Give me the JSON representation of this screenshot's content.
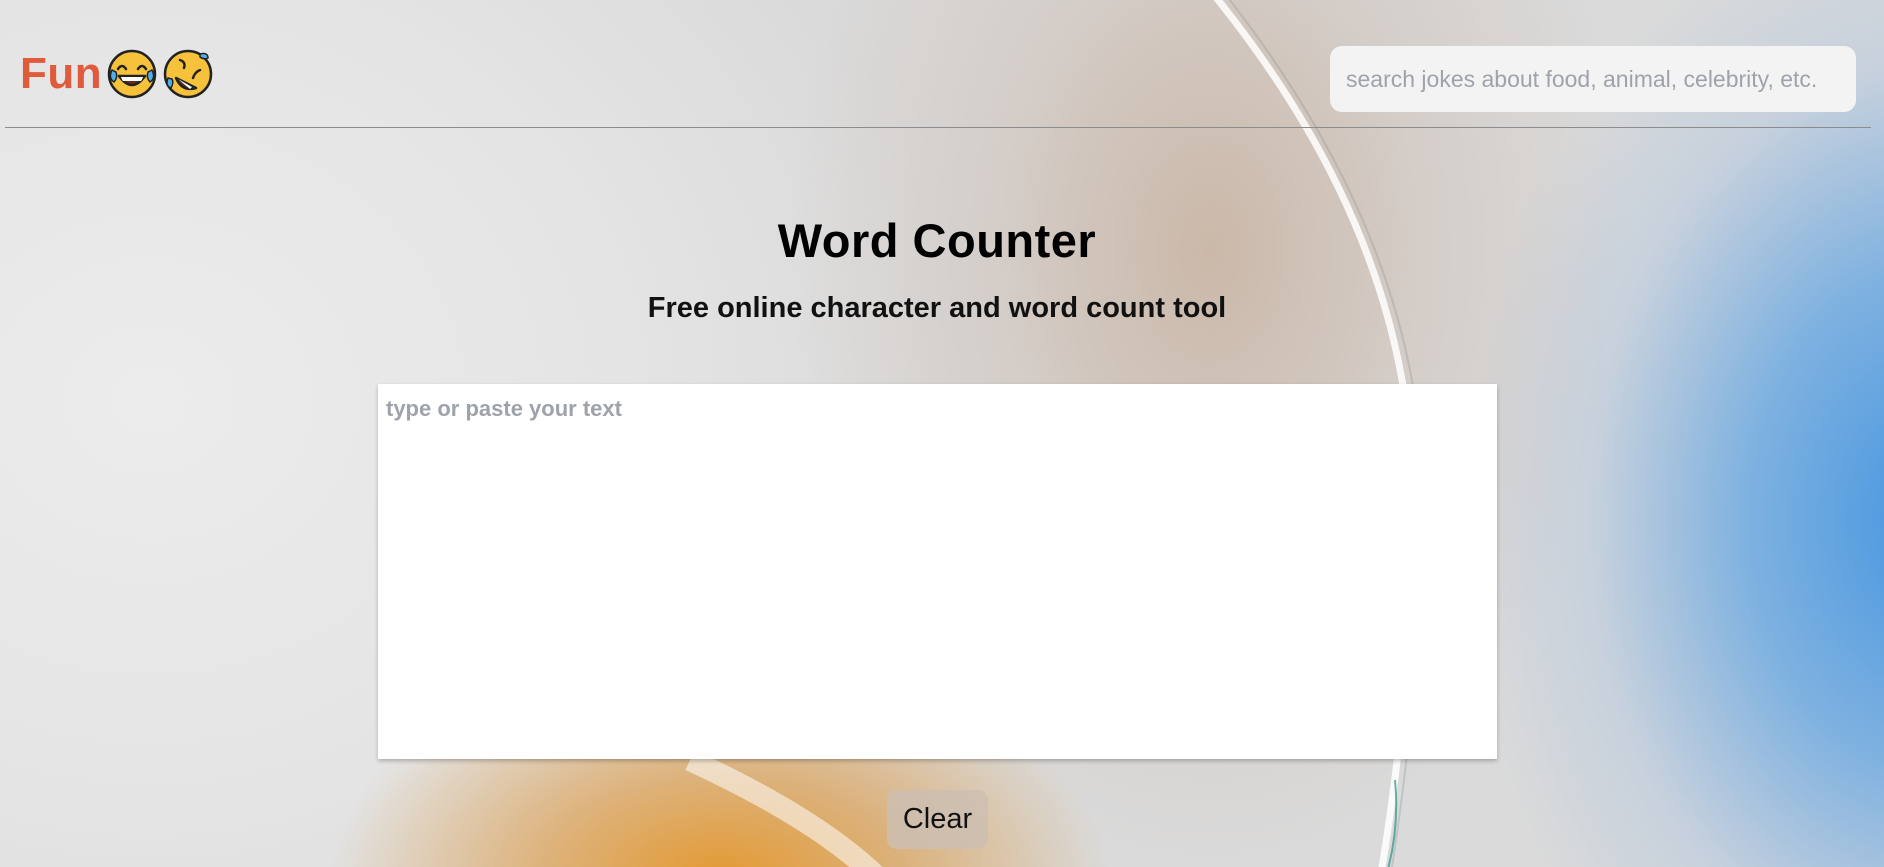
{
  "header": {
    "logo_text": "Fun",
    "logo_icons": [
      "joy-emoji-icon",
      "rofl-emoji-icon"
    ],
    "search_placeholder": "search jokes about food, animal, celebrity, etc.",
    "search_value": ""
  },
  "main": {
    "title": "Word Counter",
    "subtitle": "Free online character and word count tool",
    "textarea_placeholder": "type or paste your text",
    "textarea_value": "",
    "clear_label": "Clear"
  },
  "colors": {
    "logo": "#e05a3c",
    "search_bg": "#f3f3f4",
    "placeholder": "#9ea3ab",
    "accent_blue": "#4a96e1",
    "accent_orange": "#e49628"
  }
}
